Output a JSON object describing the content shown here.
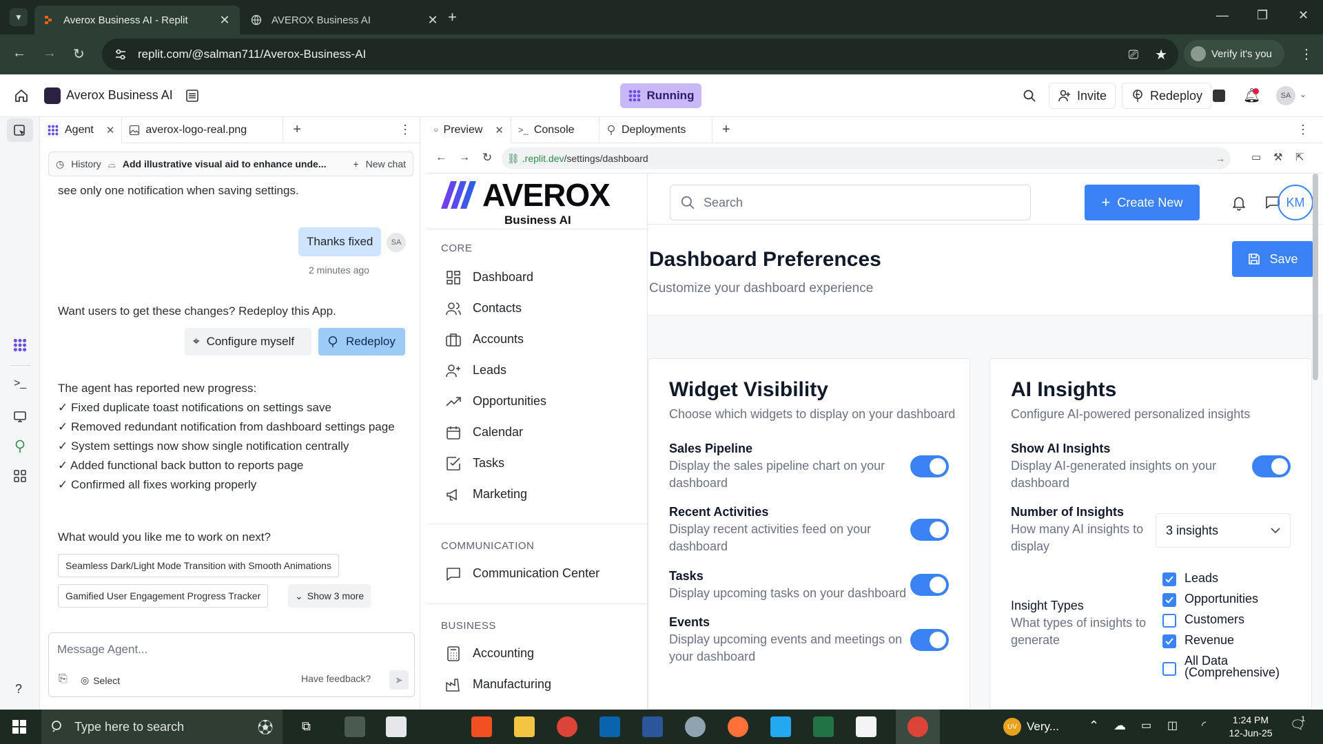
{
  "browser": {
    "tabs": [
      {
        "title": "Averox Business AI - Replit",
        "active": true
      },
      {
        "title": "AVEROX Business AI",
        "active": false
      }
    ],
    "url": "replit.com/@salman711/Averox-Business-AI",
    "verify_label": "Verify it's you"
  },
  "replit": {
    "app_name": "Averox Business AI",
    "status": "Running",
    "invite_label": "Invite",
    "redeploy_label": "Redeploy",
    "user_initials": "SA",
    "accent": "#c9b8f8"
  },
  "agent_pane": {
    "tabs": [
      "Agent",
      "averox-logo-real.png"
    ],
    "history_label": "History",
    "thread_title": "Add illustrative visual aid to enhance unde...",
    "new_chat_label": "New chat",
    "truncated_text": "see only one notification when saving settings.",
    "user_message": "Thanks fixed",
    "user_initials": "SA",
    "message_time": "2 minutes ago",
    "redeploy_prompt": "Want users to get these changes? Redeploy this App.",
    "configure_label": "Configure myself",
    "redeploy_label": "Redeploy",
    "progress_heading": "The agent has reported new progress:",
    "progress_items": [
      "✓ Fixed duplicate toast notifications on settings save",
      "✓ Removed redundant notification from dashboard settings page",
      "✓ System settings now show single notification centrally",
      "✓ Added functional back button to reports page",
      "✓ Confirmed all fixes working properly"
    ],
    "next_question": "What would you like me to work on next?",
    "suggestions": [
      "Seamless Dark/Light Mode Transition with Smooth Animations",
      "Gamified User Engagement Progress Tracker"
    ],
    "show_more_label": "Show 3 more",
    "input_placeholder": "Message Agent...",
    "select_label": "Select",
    "feedback_label": "Have feedback?"
  },
  "preview_pane": {
    "tabs": [
      "Preview",
      "Console",
      "Deployments"
    ],
    "url_host": ".replit.dev",
    "url_path": "/settings/dashboard"
  },
  "app": {
    "logo_text": "AVEROX",
    "logo_sub": "Business AI",
    "sections": [
      {
        "title": "CORE",
        "items": [
          "Dashboard",
          "Contacts",
          "Accounts",
          "Leads",
          "Opportunities",
          "Calendar",
          "Tasks",
          "Marketing"
        ]
      },
      {
        "title": "COMMUNICATION",
        "items": [
          "Communication Center"
        ]
      },
      {
        "title": "BUSINESS",
        "items": [
          "Accounting",
          "Manufacturing"
        ]
      }
    ],
    "search_placeholder": "Search",
    "create_label": "Create New",
    "avatar_initials": "KM",
    "page_title": "Dashboard Preferences",
    "page_subtitle": "Customize your dashboard experience",
    "save_label": "Save",
    "primary_color": "#3b82f6",
    "widget_card": {
      "title": "Widget Visibility",
      "subtitle": "Choose which widgets to display on your dashboard",
      "items": [
        {
          "label": "Sales Pipeline",
          "desc": "Display the sales pipeline chart on your dashboard",
          "on": true
        },
        {
          "label": "Recent Activities",
          "desc": "Display recent activities feed on your dashboard",
          "on": true
        },
        {
          "label": "Tasks",
          "desc": "Display upcoming tasks on your dashboard",
          "on": true
        },
        {
          "label": "Events",
          "desc": "Display upcoming events and meetings on your dashboard",
          "on": true
        }
      ]
    },
    "ai_card": {
      "title": "AI Insights",
      "subtitle": "Configure AI-powered personalized insights",
      "show_label": "Show AI Insights",
      "show_desc": "Display AI-generated insights on your dashboard",
      "count_label": "Number of Insights",
      "count_desc": "How many AI insights to display",
      "count_value": "3 insights",
      "types_label": "Insight Types",
      "types_desc": "What types of insights to generate",
      "types": [
        {
          "label": "Leads",
          "checked": true
        },
        {
          "label": "Opportunities",
          "checked": true
        },
        {
          "label": "Customers",
          "checked": false
        },
        {
          "label": "Revenue",
          "checked": true
        },
        {
          "label": "All Data\n(Comprehensive)",
          "checked": false
        }
      ]
    }
  },
  "taskbar": {
    "search_placeholder": "Type here to search",
    "weather_label": "Very...",
    "weather_badge": "UV",
    "time": "1:24 PM",
    "date": "12-Jun-25",
    "notification_count": "1"
  }
}
